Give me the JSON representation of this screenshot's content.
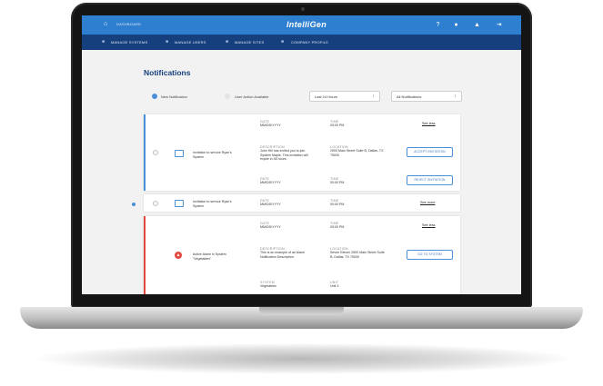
{
  "topbar": {
    "dashboard_label": "DASHBOARD",
    "logo": "IntelliGen",
    "icons": [
      "help-icon",
      "user-icon",
      "bell-icon",
      "logout-icon"
    ]
  },
  "nav": {
    "items": [
      {
        "label": "MANAGE SYSTEMS"
      },
      {
        "label": "MANAGE USERS"
      },
      {
        "label": "MANAGE SITES"
      },
      {
        "label": "COMPANY PROFILE"
      }
    ]
  },
  "page": {
    "title": "Notifications"
  },
  "legend": {
    "new_label": "New Notification",
    "action_label": "User Action Available"
  },
  "filters": {
    "time_value": "Last 24 Hours",
    "type_value": "All Notifications"
  },
  "colors": {
    "topbar": "#2f7fd0",
    "navbar": "#163f7e",
    "new_blue": "#4a90d9",
    "alarm_red": "#e24a3f"
  },
  "notifications": [
    {
      "title": "Invitation to service Ryan's System",
      "date_label": "DATE",
      "date_value": "MM/DD/YYYY",
      "time_label": "TIME",
      "time_value": "00:00 PM",
      "see_label": "See less",
      "description_label": "DESCRIPTION",
      "description": "John Hill has invited you to join System Maple. This invitation will expire in 48 hours.",
      "location_label": "LOCATION",
      "location": "2500 Main Street Suite B, Dallas, TX 75000",
      "accept_button": "ACCEPT INVITATION",
      "date2_label": "DATE",
      "date2_value": "MM/DD/YYYY",
      "time2_label": "TIME",
      "time2_value": "00:00 PM",
      "reject_button": "REJECT INVITATION"
    },
    {
      "title": "Invitation to service Ryan's System",
      "date_label": "DATE",
      "date_value": "MM/DD/YYYY",
      "time_label": "TIME",
      "time_value": "00:00 PM",
      "see_label": "See more"
    },
    {
      "title": "Active Alarm in System \"Vegetables\"",
      "date_label": "DATE",
      "date_value": "MM/DD/YYYY",
      "time_label": "TIME",
      "time_value": "00:00 PM",
      "see_label": "See less",
      "description_label": "DESCRIPTION",
      "description": "This is an example of an Alarm Notification Description.",
      "location_label": "LOCATION",
      "location": "Seven Eleven 2500 Main Street Suite B, Dallas, TX 75000",
      "system_button": "GO TO SYSTEM",
      "system_label": "SYSTEM",
      "system_value": "Vegetables",
      "unit_label": "UNIT",
      "unit_value": "Unit 3"
    }
  ]
}
